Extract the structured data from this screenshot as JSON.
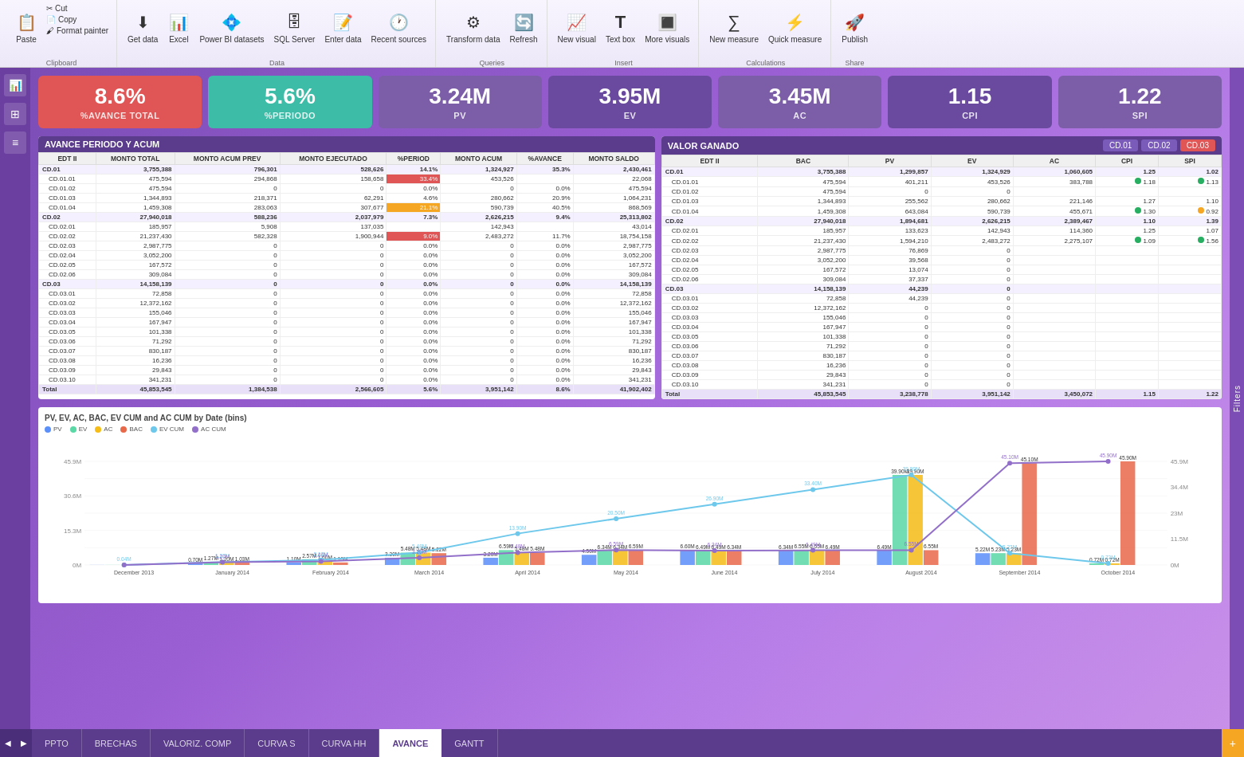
{
  "toolbar": {
    "sections": [
      {
        "name": "Clipboard",
        "label": "Clipboard",
        "buttons": [
          {
            "id": "paste",
            "label": "Paste",
            "icon": "📋"
          },
          {
            "id": "cut",
            "label": "Cut",
            "icon": "✂"
          },
          {
            "id": "copy",
            "label": "Copy",
            "icon": "📄"
          },
          {
            "id": "format-painter",
            "label": "Format painter",
            "icon": "🖌"
          }
        ]
      },
      {
        "name": "Data",
        "label": "Data",
        "buttons": [
          {
            "id": "get-data",
            "label": "Get data",
            "icon": "⬇",
            "dropdown": true
          },
          {
            "id": "excel",
            "label": "Excel",
            "icon": "📊"
          },
          {
            "id": "power-bi",
            "label": "Power BI datasets",
            "icon": "💠"
          },
          {
            "id": "sql",
            "label": "SQL Server",
            "icon": "🗄"
          },
          {
            "id": "enter-data",
            "label": "Enter data",
            "icon": "📝"
          },
          {
            "id": "recent",
            "label": "Recent sources",
            "icon": "🕐",
            "dropdown": true
          }
        ]
      },
      {
        "name": "Queries",
        "label": "Queries",
        "buttons": [
          {
            "id": "transform",
            "label": "Transform data",
            "icon": "⚙",
            "dropdown": true
          },
          {
            "id": "refresh",
            "label": "Refresh",
            "icon": "🔄"
          }
        ]
      },
      {
        "name": "Insert",
        "label": "Insert",
        "buttons": [
          {
            "id": "new-visual",
            "label": "New visual",
            "icon": "📈"
          },
          {
            "id": "text-box",
            "label": "Text box",
            "icon": "T"
          },
          {
            "id": "more-visuals",
            "label": "More visuals",
            "icon": "🔳",
            "dropdown": true
          }
        ]
      },
      {
        "name": "Calculations",
        "label": "Calculations",
        "buttons": [
          {
            "id": "new-measure",
            "label": "New measure",
            "icon": "∑"
          },
          {
            "id": "quick-measure",
            "label": "Quick measure",
            "icon": "⚡"
          }
        ]
      },
      {
        "name": "Share",
        "label": "Share",
        "buttons": [
          {
            "id": "publish",
            "label": "Publish",
            "icon": "🚀"
          }
        ]
      }
    ]
  },
  "kpis": [
    {
      "value": "8.6%",
      "label": "%AVANCE TOTAL",
      "color": "red"
    },
    {
      "value": "5.6%",
      "label": "%PERIODO",
      "color": "teal"
    },
    {
      "value": "3.24M",
      "label": "PV",
      "color": "purple"
    },
    {
      "value": "3.95M",
      "label": "EV",
      "color": "dark-purple"
    },
    {
      "value": "3.45M",
      "label": "AC",
      "color": "purple"
    },
    {
      "value": "1.15",
      "label": "CPI",
      "color": "dark-purple"
    },
    {
      "value": "1.22",
      "label": "SPI",
      "color": "purple"
    }
  ],
  "avance_table": {
    "title": "AVANCE PERIODO Y ACUM",
    "headers": [
      "EDT II",
      "MONTO TOTAL",
      "MONTO ACUM PREV",
      "MONTO EJECUTADO",
      "%PERIOD",
      "MONTO ACUM",
      "%AVANCE",
      "MONTO SALDO"
    ],
    "rows": [
      {
        "id": "CD.01",
        "label": "CD.01",
        "indent": false,
        "values": [
          "3,755,388",
          "796,301",
          "528,626",
          "14.1%",
          "1,324,927",
          "35.3%",
          "2,430,461"
        ]
      },
      {
        "id": "CD.01.01",
        "label": "CD.01.01",
        "indent": true,
        "values": [
          "475,594",
          "294,868",
          "158,658",
          "33.4%",
          "453,526",
          "",
          "22,068"
        ],
        "highlight": "red"
      },
      {
        "id": "CD.01.02",
        "label": "CD.01.02",
        "indent": true,
        "values": [
          "475,594",
          "0",
          "0",
          "0.0%",
          "0",
          "0.0%",
          "475,594"
        ]
      },
      {
        "id": "CD.01.03",
        "label": "CD.01.03",
        "indent": true,
        "values": [
          "1,344,893",
          "218,371",
          "62,291",
          "4.6%",
          "280,662",
          "20.9%",
          "1,064,231"
        ]
      },
      {
        "id": "CD.01.04",
        "label": "CD.01.04",
        "indent": true,
        "values": [
          "1,459,308",
          "283,063",
          "307,677",
          "21.1%",
          "590,739",
          "40.5%",
          "868,569"
        ],
        "highlight": "orange"
      },
      {
        "id": "CD.02",
        "label": "CD.02",
        "indent": false,
        "values": [
          "27,940,018",
          "588,236",
          "2,037,979",
          "7.3%",
          "2,626,215",
          "9.4%",
          "25,313,802"
        ]
      },
      {
        "id": "CD.02.01",
        "label": "CD.02.01",
        "indent": true,
        "values": [
          "185,957",
          "5,908",
          "137,035",
          "",
          "142,943",
          "",
          "43,014"
        ]
      },
      {
        "id": "CD.02.02",
        "label": "CD.02.02",
        "indent": true,
        "values": [
          "21,237,430",
          "582,328",
          "1,900,944",
          "9.0%",
          "2,483,272",
          "11.7%",
          "18,754,158"
        ],
        "highlight": "red"
      },
      {
        "id": "CD.02.03",
        "label": "CD.02.03",
        "indent": true,
        "values": [
          "2,987,775",
          "0",
          "0",
          "0.0%",
          "0",
          "0.0%",
          "2,987,775"
        ]
      },
      {
        "id": "CD.02.04",
        "label": "CD.02.04",
        "indent": true,
        "values": [
          "3,052,200",
          "0",
          "0",
          "0.0%",
          "0",
          "0.0%",
          "3,052,200"
        ]
      },
      {
        "id": "CD.02.05",
        "label": "CD.02.05",
        "indent": true,
        "values": [
          "167,572",
          "0",
          "0",
          "0.0%",
          "0",
          "0.0%",
          "167,572"
        ]
      },
      {
        "id": "CD.02.06",
        "label": "CD.02.06",
        "indent": true,
        "values": [
          "309,084",
          "0",
          "0",
          "0.0%",
          "0",
          "0.0%",
          "309,084"
        ]
      },
      {
        "id": "CD.03",
        "label": "CD.03",
        "indent": false,
        "values": [
          "14,158,139",
          "0",
          "0",
          "0.0%",
          "0",
          "0.0%",
          "14,158,139"
        ]
      },
      {
        "id": "CD.03.01",
        "label": "CD.03.01",
        "indent": true,
        "values": [
          "72,858",
          "0",
          "0",
          "0.0%",
          "0",
          "0.0%",
          "72,858"
        ]
      },
      {
        "id": "CD.03.02",
        "label": "CD.03.02",
        "indent": true,
        "values": [
          "12,372,162",
          "0",
          "0",
          "0.0%",
          "0",
          "0.0%",
          "12,372,162"
        ]
      },
      {
        "id": "CD.03.03",
        "label": "CD.03.03",
        "indent": true,
        "values": [
          "155,046",
          "0",
          "0",
          "0.0%",
          "0",
          "0.0%",
          "155,046"
        ]
      },
      {
        "id": "CD.03.04",
        "label": "CD.03.04",
        "indent": true,
        "values": [
          "167,947",
          "0",
          "0",
          "0.0%",
          "0",
          "0.0%",
          "167,947"
        ]
      },
      {
        "id": "CD.03.05",
        "label": "CD.03.05",
        "indent": true,
        "values": [
          "101,338",
          "0",
          "0",
          "0.0%",
          "0",
          "0.0%",
          "101,338"
        ]
      },
      {
        "id": "CD.03.06",
        "label": "CD.03.06",
        "indent": true,
        "values": [
          "71,292",
          "0",
          "0",
          "0.0%",
          "0",
          "0.0%",
          "71,292"
        ]
      },
      {
        "id": "CD.03.07",
        "label": "CD.03.07",
        "indent": true,
        "values": [
          "830,187",
          "0",
          "0",
          "0.0%",
          "0",
          "0.0%",
          "830,187"
        ]
      },
      {
        "id": "CD.03.08",
        "label": "CD.03.08",
        "indent": true,
        "values": [
          "16,236",
          "0",
          "0",
          "0.0%",
          "0",
          "0.0%",
          "16,236"
        ]
      },
      {
        "id": "CD.03.09",
        "label": "CD.03.09",
        "indent": true,
        "values": [
          "29,843",
          "0",
          "0",
          "0.0%",
          "0",
          "0.0%",
          "29,843"
        ]
      },
      {
        "id": "CD.03.10",
        "label": "CD.03.10",
        "indent": true,
        "values": [
          "341,231",
          "0",
          "0",
          "0.0%",
          "0",
          "0.0%",
          "341,231"
        ]
      },
      {
        "id": "Total",
        "label": "Total",
        "indent": false,
        "values": [
          "45,853,545",
          "1,384,538",
          "2,566,605",
          "5.6%",
          "3,951,142",
          "8.6%",
          "41,902,402"
        ],
        "total": true
      }
    ]
  },
  "valor_ganado_table": {
    "title": "VALOR GANADO",
    "cd_buttons": [
      "CD.01",
      "CD.02",
      "CD.03"
    ],
    "headers": [
      "EDT II",
      "BAC",
      "PV",
      "EV",
      "AC",
      "CPI",
      "SPI"
    ],
    "rows": [
      {
        "id": "CD.01",
        "label": "CD.01",
        "indent": false,
        "values": [
          "3,755,388",
          "1,299,857",
          "1,324,929",
          "1,060,605",
          "1.25",
          "1.02"
        ]
      },
      {
        "id": "CD.01.01",
        "label": "CD.01.01",
        "indent": true,
        "values": [
          "475,594",
          "401,211",
          "453,526",
          "383,788",
          "1.18",
          "1.13"
        ],
        "dots": [
          "green",
          "green"
        ]
      },
      {
        "id": "CD.01.02",
        "label": "CD.01.02",
        "indent": true,
        "values": [
          "475,594",
          "0",
          "0",
          "",
          "",
          ""
        ]
      },
      {
        "id": "CD.01.03",
        "label": "CD.01.03",
        "indent": true,
        "values": [
          "1,344,893",
          "255,562",
          "280,662",
          "221,146",
          "1.27",
          "1.10"
        ]
      },
      {
        "id": "CD.01.04",
        "label": "CD.01.04",
        "indent": true,
        "values": [
          "1,459,308",
          "643,084",
          "590,739",
          "455,671",
          "1.30",
          "0.92"
        ],
        "dots": [
          "green",
          "orange"
        ]
      },
      {
        "id": "CD.02",
        "label": "CD.02",
        "indent": false,
        "values": [
          "27,940,018",
          "1,894,681",
          "2,626,215",
          "2,389,467",
          "1.10",
          "1.39"
        ]
      },
      {
        "id": "CD.02.01",
        "label": "CD.02.01",
        "indent": true,
        "values": [
          "185,957",
          "133,623",
          "142,943",
          "114,360",
          "1.25",
          "1.07"
        ]
      },
      {
        "id": "CD.02.02",
        "label": "CD.02.02",
        "indent": true,
        "values": [
          "21,237,430",
          "1,594,210",
          "2,483,272",
          "2,275,107",
          "1.09",
          "1.56"
        ],
        "dots": [
          "green",
          "green"
        ]
      },
      {
        "id": "CD.02.03",
        "label": "CD.02.03",
        "indent": true,
        "values": [
          "2,987,775",
          "76,869",
          "0",
          "",
          "",
          ""
        ]
      },
      {
        "id": "CD.02.04",
        "label": "CD.02.04",
        "indent": true,
        "values": [
          "3,052,200",
          "39,568",
          "0",
          "",
          "",
          ""
        ]
      },
      {
        "id": "CD.02.05",
        "label": "CD.02.05",
        "indent": true,
        "values": [
          "167,572",
          "13,074",
          "0",
          "",
          "",
          ""
        ]
      },
      {
        "id": "CD.02.06",
        "label": "CD.02.06",
        "indent": true,
        "values": [
          "309,084",
          "37,337",
          "0",
          "",
          "",
          ""
        ]
      },
      {
        "id": "CD.03",
        "label": "CD.03",
        "indent": false,
        "values": [
          "14,158,139",
          "44,239",
          "0",
          "",
          "",
          ""
        ]
      },
      {
        "id": "CD.03.01",
        "label": "CD.03.01",
        "indent": true,
        "values": [
          "72,858",
          "44,239",
          "0",
          "",
          "",
          ""
        ]
      },
      {
        "id": "CD.03.02",
        "label": "CD.03.02",
        "indent": true,
        "values": [
          "12,372,162",
          "0",
          "0",
          "",
          "",
          ""
        ]
      },
      {
        "id": "CD.03.03",
        "label": "CD.03.03",
        "indent": true,
        "values": [
          "155,046",
          "0",
          "0",
          "",
          "",
          ""
        ]
      },
      {
        "id": "CD.03.04",
        "label": "CD.03.04",
        "indent": true,
        "values": [
          "167,947",
          "0",
          "0",
          "",
          "",
          ""
        ]
      },
      {
        "id": "CD.03.05",
        "label": "CD.03.05",
        "indent": true,
        "values": [
          "101,338",
          "0",
          "0",
          "",
          "",
          ""
        ]
      },
      {
        "id": "CD.03.06",
        "label": "CD.03.06",
        "indent": true,
        "values": [
          "71,292",
          "0",
          "0",
          "",
          "",
          ""
        ]
      },
      {
        "id": "CD.03.07",
        "label": "CD.03.07",
        "indent": true,
        "values": [
          "830,187",
          "0",
          "0",
          "",
          "",
          ""
        ]
      },
      {
        "id": "CD.03.08",
        "label": "CD.03.08",
        "indent": true,
        "values": [
          "16,236",
          "0",
          "0",
          "",
          "",
          ""
        ]
      },
      {
        "id": "CD.03.09",
        "label": "CD.03.09",
        "indent": true,
        "values": [
          "29,843",
          "0",
          "0",
          "",
          "",
          ""
        ]
      },
      {
        "id": "CD.03.10",
        "label": "CD.03.10",
        "indent": true,
        "values": [
          "341,231",
          "0",
          "0",
          "",
          "",
          ""
        ]
      },
      {
        "id": "Total",
        "label": "Total",
        "indent": false,
        "values": [
          "45,853,545",
          "3,238,778",
          "3,951,142",
          "3,450,072",
          "1.15",
          "1.22"
        ],
        "total": true
      }
    ]
  },
  "chart": {
    "title": "PV, EV, AC, BAC, EV CUM and AC CUM by Date (bins)",
    "legend": [
      {
        "label": "PV",
        "color": "#5b8ff9"
      },
      {
        "label": "EV",
        "color": "#5ad8a6"
      },
      {
        "label": "AC",
        "color": "#f6bd16"
      },
      {
        "label": "BAC",
        "color": "#e8684a"
      },
      {
        "label": "EV CUM",
        "color": "#6dc8ec"
      },
      {
        "label": "AC CUM",
        "color": "#9270ca"
      }
    ],
    "months": [
      "December 2013",
      "January 2014",
      "February 2014",
      "March 2014",
      "April 2014",
      "May 2014",
      "June 2014",
      "July 2014",
      "August 2014",
      "September 2014",
      "October 2014"
    ],
    "pv_bars": [
      0.04,
      0.7,
      1.1,
      3.2,
      3.2,
      4.5,
      6.6,
      6.34,
      6.49,
      5.22,
      0
    ],
    "ev_bars": [
      0.04,
      1.27,
      2.57,
      5.48,
      6.59,
      6.34,
      6.49,
      6.55,
      39.9,
      5.23,
      0.72
    ],
    "ac_bars": [
      0,
      1.2,
      1.6,
      5.48,
      5.48,
      6.34,
      6.49,
      6.55,
      39.9,
      5.23,
      0.72
    ],
    "bac_bars": [
      0.04,
      1.03,
      1.1,
      5.22,
      5.48,
      6.59,
      6.34,
      6.49,
      6.55,
      45.1,
      45.9
    ],
    "ev_cum": [
      0.04,
      1.27,
      2.17,
      5.48,
      13.9,
      20.5,
      26.9,
      33.4,
      39.9,
      5.23,
      0.72
    ],
    "ac_cum": [
      0,
      1.2,
      1.6,
      3.2,
      5.48,
      6.59,
      6.34,
      6.49,
      6.55,
      45.1,
      45.9
    ],
    "bar_labels": [
      "0.04M",
      "0.7M",
      "1.1M\n1.2M\n1.27M",
      "3.2M\n2.6M\n2.17M",
      "5.22M\n5.48M\n1.6M",
      "4.5M\n5.48M",
      "6.59M\n13.9M",
      "6.34M\n20.5M\n26.9M",
      "6.49M\n33.4M",
      "6.55M\n39.9M\n5.23M",
      "45.1M\n45.9M\n0.72M"
    ]
  },
  "tabs": [
    {
      "label": "PPTO",
      "active": false
    },
    {
      "label": "BRECHAS",
      "active": false
    },
    {
      "label": "VALORIZ. COMP",
      "active": false
    },
    {
      "label": "CURVA S",
      "active": false
    },
    {
      "label": "CURVA HH",
      "active": false
    },
    {
      "label": "AVANCE",
      "active": true
    },
    {
      "label": "GANTT",
      "active": false
    }
  ],
  "sidebar_icons": [
    "📊",
    "⊞",
    "≡"
  ],
  "filters_label": "Filters"
}
